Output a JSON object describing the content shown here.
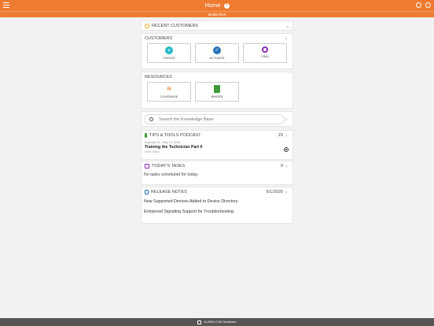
{
  "header": {
    "title": "Home",
    "subtitle": "MobileTech"
  },
  "recent_customers": {
    "label": "RECENT CUSTOMERS"
  },
  "customers": {
    "label": "CUSTOMERS",
    "tiles": [
      {
        "label": "CREATE",
        "icon": "plus-circle-icon",
        "color": "#22b8c6"
      },
      {
        "label": "ACTIVATE",
        "icon": "check-circle-icon",
        "color": "#2a74b8"
      },
      {
        "label": "FIND",
        "icon": "magnifier-icon",
        "color": "#8a2bb4"
      }
    ]
  },
  "resources": {
    "label": "RESOURCES",
    "tiles": [
      {
        "label": "COVERAGE",
        "icon": "wifi-signal-icon",
        "color": "#ef7b31"
      },
      {
        "label": "BINDER",
        "icon": "book-icon",
        "color": "#3f9b3a"
      }
    ]
  },
  "search": {
    "placeholder": "Search the Knowledge Base"
  },
  "podcast": {
    "label": "TIPS & TOOLS PODCAST",
    "count": "23",
    "episode_meta": "Episode 23 - May 12, 2016",
    "episode_title": "Training the Technician Part II",
    "duration": "9min 19sec"
  },
  "tasks": {
    "label": "TODAY'S TASKS",
    "count": "0",
    "empty_text": "No tasks scheduled for today."
  },
  "release_notes": {
    "label": "RELEASE NOTES",
    "date": "6/1/2020",
    "items": [
      "New Supported Devices Added to Device Directory",
      "Enhanced Signaling Support for Troubleshooting"
    ]
  },
  "footer": {
    "text": "ALARM.COM Restricted"
  },
  "colors": {
    "accent": "#ef7b31",
    "background": "#f2f2f2"
  }
}
